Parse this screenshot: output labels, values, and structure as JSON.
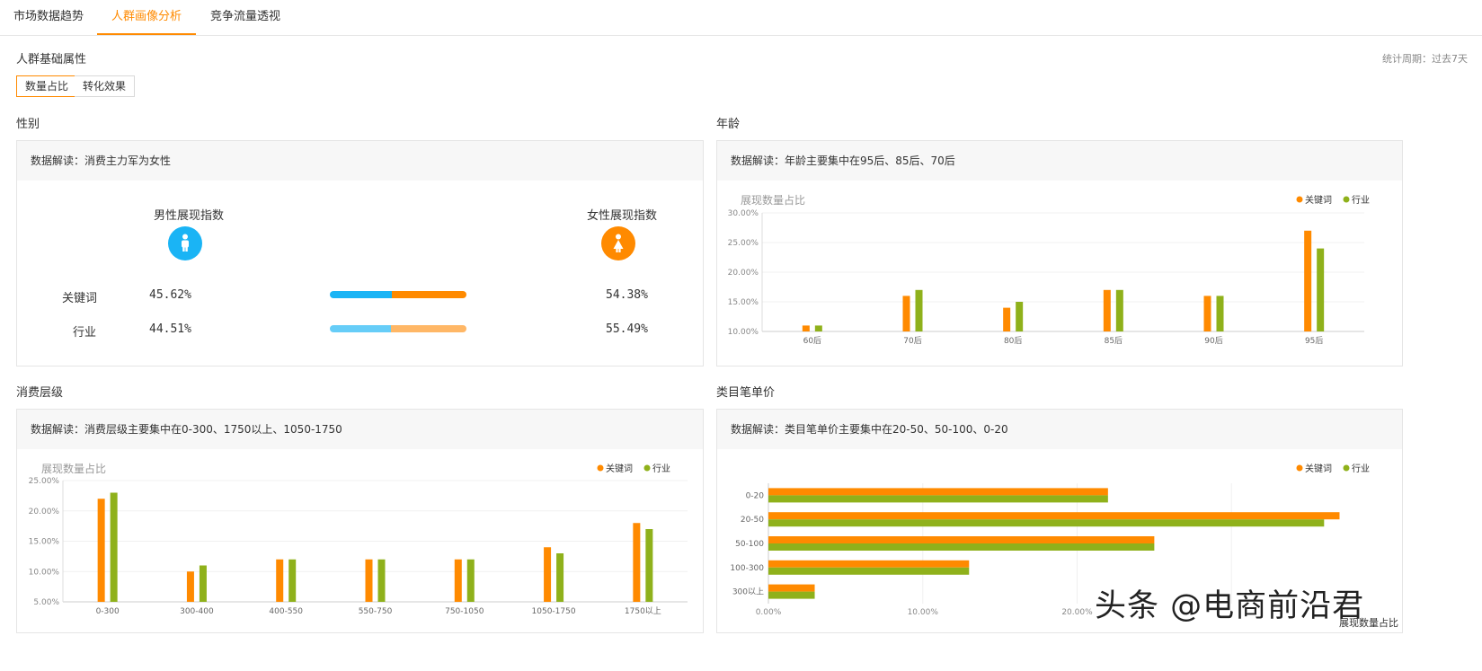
{
  "tabs": [
    {
      "label": "市场数据趋势",
      "active": false
    },
    {
      "label": "人群画像分析",
      "active": true
    },
    {
      "label": "竞争流量透视",
      "active": false
    }
  ],
  "section_title": "人群基础属性",
  "period": "统计周期：过去7天",
  "toggles": [
    {
      "label": "数量占比",
      "active": true
    },
    {
      "label": "转化效果",
      "active": false
    }
  ],
  "colors": {
    "keyword": "#ff8a00",
    "industry": "#8fb11b",
    "male": "#1ab4f5",
    "female": "#ff8a00",
    "male_light": "#66cdf8",
    "female_light": "#ffb766",
    "accent": "#ff8a00"
  },
  "gender": {
    "title": "性别",
    "insight": "数据解读：消费主力军为女性",
    "male_label": "男性展现指数",
    "female_label": "女性展现指数",
    "male_icon": "male-person-icon",
    "female_icon": "female-person-icon",
    "rows": [
      {
        "label": "关键词",
        "male": "45.62%",
        "female": "54.38%",
        "male_share": 45.62
      },
      {
        "label": "行业",
        "male": "44.51%",
        "female": "55.49%",
        "male_share": 44.51
      }
    ]
  },
  "legend": {
    "keyword": "关键词",
    "industry": "行业"
  },
  "chart_data": [
    {
      "id": "age",
      "type": "bar",
      "title": "年龄",
      "insight": "数据解读：年龄主要集中在95后、85后、70后",
      "ylabel": "展现数量占比",
      "categories": [
        "60后",
        "70后",
        "80后",
        "85后",
        "90后",
        "95后"
      ],
      "series": [
        {
          "name": "关键词",
          "values": [
            11,
            16,
            14,
            17,
            16,
            27
          ]
        },
        {
          "name": "行业",
          "values": [
            11,
            17,
            15,
            17,
            16,
            24
          ]
        }
      ],
      "ylim": [
        10,
        30
      ],
      "yticks": [
        "10.00%",
        "15.00%",
        "20.00%",
        "25.00%",
        "30.00%"
      ],
      "legend_position": "top-right",
      "grid": true
    },
    {
      "id": "consumption",
      "type": "bar",
      "title": "消费层级",
      "insight": "数据解读：消费层级主要集中在0-300、1750以上、1050-1750",
      "ylabel": "展现数量占比",
      "categories": [
        "0-300",
        "300-400",
        "400-550",
        "550-750",
        "750-1050",
        "1050-1750",
        "1750以上"
      ],
      "series": [
        {
          "name": "关键词",
          "values": [
            22,
            10,
            12,
            12,
            12,
            14,
            18
          ]
        },
        {
          "name": "行业",
          "values": [
            23,
            11,
            12,
            12,
            12,
            13,
            17
          ]
        }
      ],
      "ylim": [
        5,
        25
      ],
      "yticks": [
        "5.00%",
        "10.00%",
        "15.00%",
        "20.00%",
        "25.00%"
      ],
      "legend_position": "top-right",
      "grid": true
    },
    {
      "id": "price",
      "type": "bar",
      "orientation": "horizontal",
      "title": "类目笔单价",
      "insight": "数据解读：类目笔单价主要集中在20-50、50-100、0-20",
      "xlabel": "展现数量占比",
      "categories": [
        "0-20",
        "20-50",
        "50-100",
        "100-300",
        "300以上"
      ],
      "series": [
        {
          "name": "关键词",
          "values": [
            22,
            37,
            25,
            13,
            3
          ]
        },
        {
          "name": "行业",
          "values": [
            22,
            36,
            25,
            13,
            3
          ]
        }
      ],
      "xlim": [
        0,
        40
      ],
      "xticks": [
        "0.00%",
        "10.00%",
        "20.00%"
      ],
      "legend_position": "top-right",
      "grid": true
    }
  ],
  "watermark": "头条 @电商前沿君"
}
